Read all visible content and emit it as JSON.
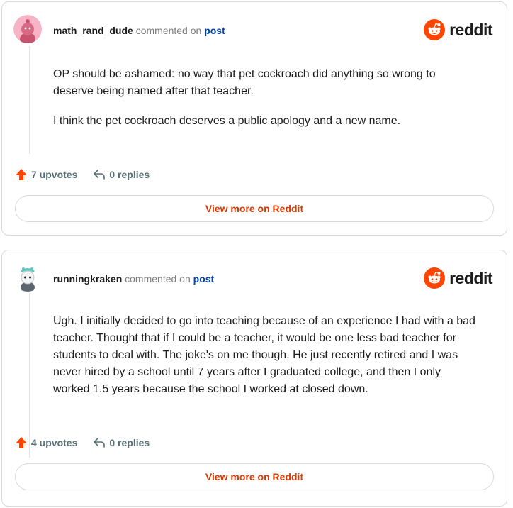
{
  "brand": {
    "wordmark": "reddit"
  },
  "colors": {
    "accent": "#ff4500",
    "link": "#0045ac",
    "button_text": "#d93a00"
  },
  "comments": [
    {
      "username": "math_rand_dude",
      "commented_on": "commented on",
      "post_link": "post",
      "paragraphs": [
        "OP should be ashamed: no way that pet cockroach did anything so wrong to deserve being named after that teacher.",
        "I think the pet cockroach deserves a public apology and a new name."
      ],
      "upvotes": "7 upvotes",
      "replies": "0 replies",
      "view_more": "View more on Reddit"
    },
    {
      "username": "runningkraken",
      "commented_on": "commented on",
      "post_link": "post",
      "paragraphs": [
        "Ugh. I initially decided to go into teaching because of an experience I had with a bad teacher. Thought that if I could be a teacher, it would be one less bad teacher for students to deal with. The joke's on me though. He just recently retired and I was never hired by a school until 7 years after I graduated college, and then I only worked 1.5 years because the school I worked at closed down."
      ],
      "upvotes": "4 upvotes",
      "replies": "0 replies",
      "view_more": "View more on Reddit"
    }
  ]
}
